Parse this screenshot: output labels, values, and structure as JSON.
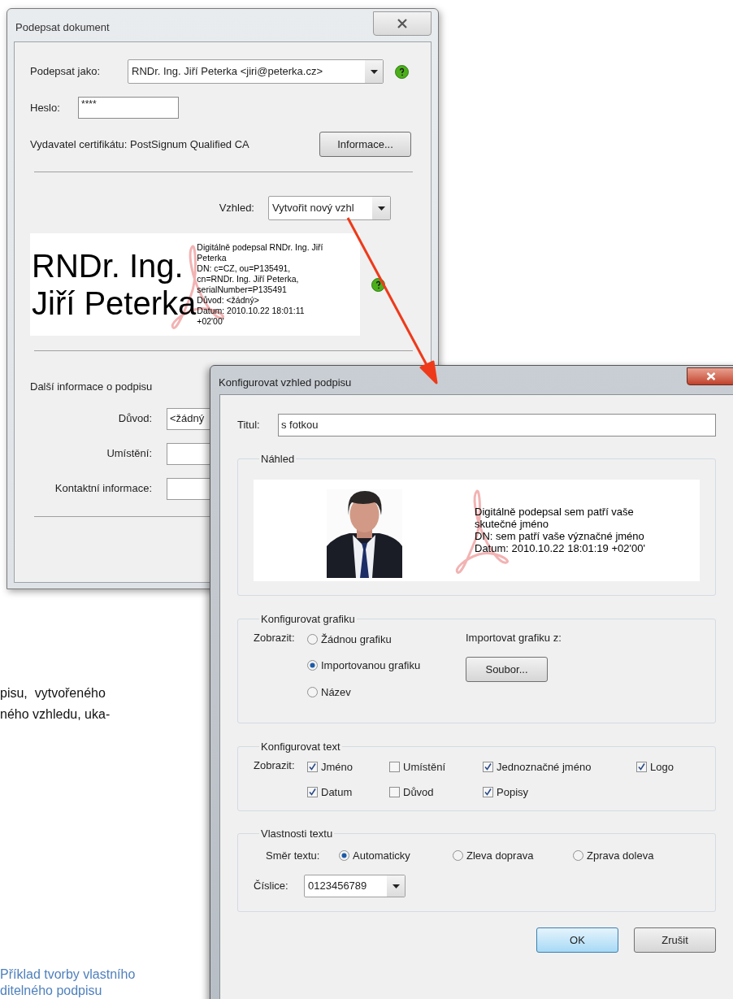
{
  "document_text": {
    "lines": [
      "pisu,  vytvořeného",
      "ného vzhledu, uka-"
    ]
  },
  "caption": {
    "lines": [
      "Příklad tvorby vlastního",
      "ditelného podpisu"
    ]
  },
  "sign_dialog": {
    "title": "Podepsat dokument",
    "sign_as": {
      "label": "Podepsat jako:",
      "value": "RNDr. Ing. Jiří Peterka <jiri@peterka.cz>"
    },
    "password": {
      "label": "Heslo:",
      "value": "****"
    },
    "issuer": "Vydavatel certifikátu: PostSignum Qualified CA",
    "info_button": "Informace...",
    "appearance": {
      "label": "Vzhled:",
      "value": "Vytvořit nový vzhl"
    },
    "preview": {
      "name_lines": [
        "RNDr. Ing.",
        "Jiří Peterka"
      ],
      "details": [
        "Digitálně podepsal RNDr. Ing. Jiří",
        "Peterka",
        "DN: c=CZ, ou=P135491,",
        "cn=RNDr. Ing. Jiří Peterka,",
        "serialNumber=P135491",
        "Důvod: <žádný>",
        "Datum: 2010.10.22 18:01:11",
        "+02'00'"
      ]
    },
    "more_info": {
      "heading": "Další informace o podpisu",
      "fields": [
        {
          "label": "Důvod:",
          "value": "<žádný"
        },
        {
          "label": "Umístění:"
        },
        {
          "label": "Kontaktní informace:"
        }
      ]
    }
  },
  "config_dialog": {
    "title": "Konfigurovat vzhled podpisu",
    "title_field": {
      "label": "Titul:",
      "value": "s fotkou"
    },
    "preview": {
      "heading": "Náhled",
      "details": [
        "Digitálně podepsal sem patří vaše",
        "skutečné jméno",
        "DN: sem patří vaše význačné jméno",
        "Datum: 2010.10.22 18:01:19 +02'00'"
      ]
    },
    "graphics": {
      "heading": "Konfigurovat grafiku",
      "label": "Zobrazit:",
      "options": [
        {
          "label": "Žádnou grafiku",
          "selected": false
        },
        {
          "label": "Importovanou grafiku",
          "selected": true
        },
        {
          "label": "Název",
          "selected": false
        }
      ],
      "import_label": "Importovat grafiku z:",
      "file_button": "Soubor..."
    },
    "text": {
      "heading": "Konfigurovat text",
      "label": "Zobrazit:",
      "options": [
        {
          "label": "Jméno",
          "checked": true
        },
        {
          "label": "Umístění",
          "checked": false
        },
        {
          "label": "Jednoznačné jméno",
          "checked": true
        },
        {
          "label": "Logo",
          "checked": true
        },
        {
          "label": "Datum",
          "checked": true
        },
        {
          "label": "Důvod",
          "checked": false
        },
        {
          "label": "Popisy",
          "checked": true
        }
      ]
    },
    "text_props": {
      "heading": "Vlastnosti textu",
      "direction_label": "Směr textu:",
      "directions": [
        {
          "label": "Automaticky",
          "selected": true
        },
        {
          "label": "Zleva doprava",
          "selected": false
        },
        {
          "label": "Zprava doleva",
          "selected": false
        }
      ],
      "digits": {
        "label": "Číslice:",
        "value": "0123456789"
      }
    },
    "buttons": [
      {
        "label": "OK",
        "default": true
      },
      {
        "label": "Zrušit",
        "default": false
      }
    ]
  }
}
